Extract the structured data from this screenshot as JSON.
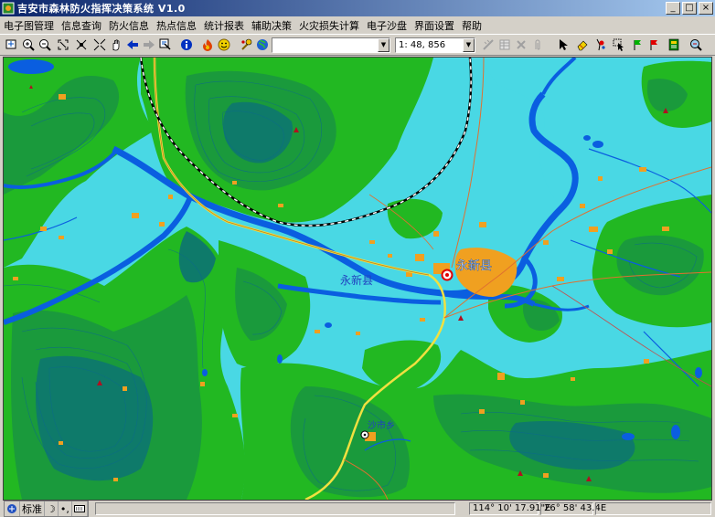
{
  "window": {
    "title": "吉安市森林防火指挥决策系统 V1.0"
  },
  "menu": {
    "items": [
      "电子图管理",
      "信息查询",
      "防火信息",
      "热点信息",
      "统计报表",
      "辅助决策",
      "火灾损失计算",
      "电子沙盘",
      "界面设置",
      "帮助"
    ]
  },
  "toolbar": {
    "layer_select_value": "",
    "scale_value": "1: 48, 856",
    "icons": [
      "layer-icon",
      "zoom-in-icon",
      "zoom-out-icon",
      "fullscreen-icon",
      "zoom-extent-icon",
      "pan-hand-icon",
      "back-arrow-icon",
      "forward-arrow-icon",
      "identify-icon",
      "info-icon",
      "fire-icon",
      "smiley-icon",
      "settings-icon",
      "globe-icon",
      "measure-icon",
      "table-icon",
      "delete-icon",
      "attach-icon",
      "pointer-icon",
      "eraser-icon",
      "flag-icon",
      "select-icon",
      "green-flag-icon",
      "red-flag-icon",
      "book-icon",
      "zoom-icon"
    ]
  },
  "map": {
    "labels": {
      "town_center": "永新县",
      "region_left": "永新县",
      "village": "沙市乡"
    },
    "colors": {
      "water": "#0a5ee0",
      "plain": "#49d8e4",
      "hill": "#22b822",
      "mountain": "#1a9a3c",
      "dark_mountain": "#0e7a6a",
      "settlement": "#f0a020",
      "road": "#f0e040",
      "boundary": "#000000"
    }
  },
  "statusbar": {
    "ime_mode": "标准",
    "longitude": "114° 10' 17.91\"E",
    "latitude": "26° 58' 43.4E"
  }
}
